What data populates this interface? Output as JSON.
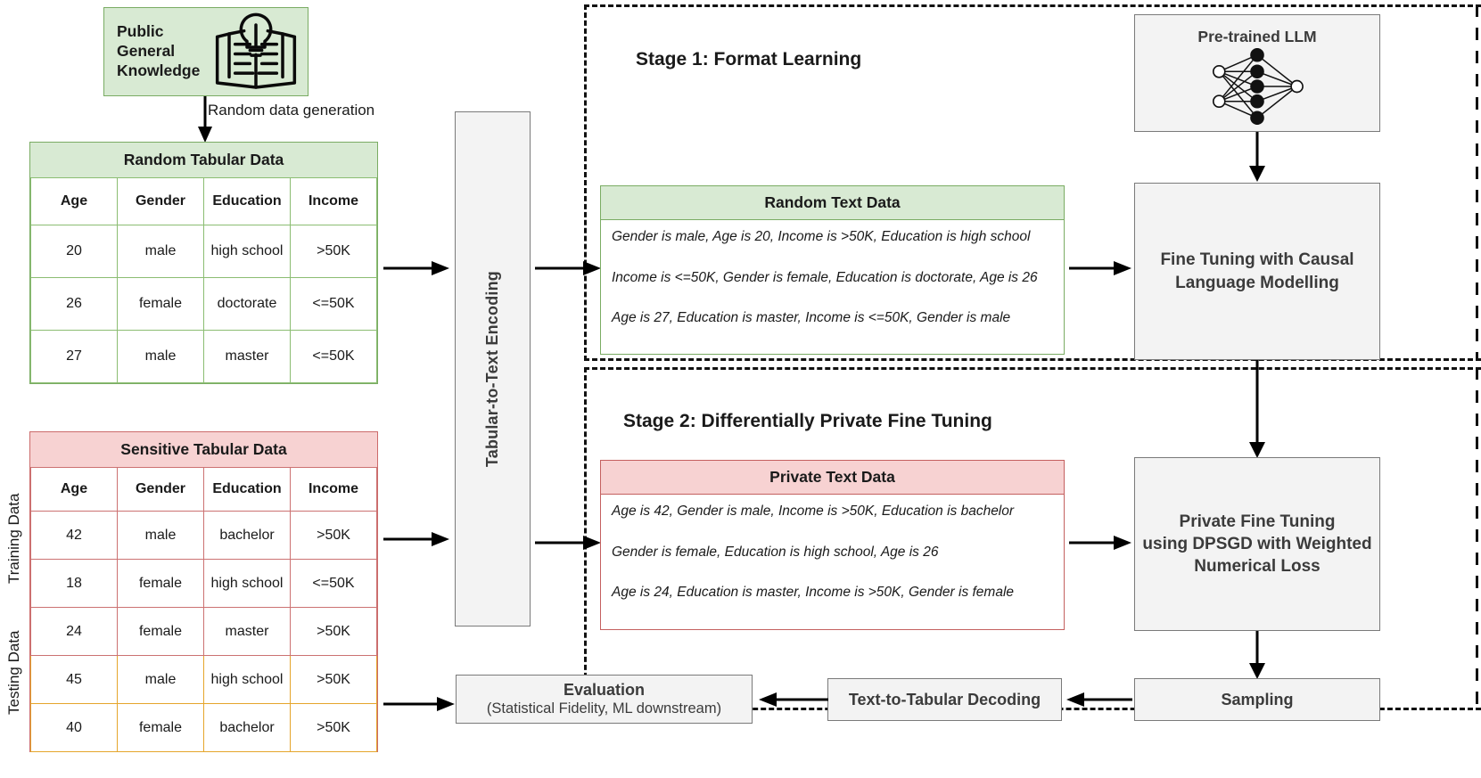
{
  "public_knowledge": {
    "label": "Public\nGeneral\nKnowledge",
    "line1": "Public",
    "line2": "General",
    "line3": "Knowledge",
    "icon": "open-book-lightbulb-icon",
    "fill": "#d8ead3",
    "stroke": "#7aac63"
  },
  "arrows": {
    "random_data_generation": "Random data generation"
  },
  "random_table": {
    "title": "Random Tabular Data",
    "fill": "#d8ead3",
    "stroke": "#7aac63",
    "columns": [
      "Age",
      "Gender",
      "Education",
      "Income"
    ],
    "rows": [
      [
        "20",
        "male",
        "high school",
        ">50K"
      ],
      [
        "26",
        "female",
        "doctorate",
        "<=50K"
      ],
      [
        "27",
        "male",
        "master",
        "<=50K"
      ]
    ]
  },
  "sensitive_table": {
    "title": "Sensitive Tabular Data",
    "fill": "#f7d2d2",
    "stroke": "#cc6b6b",
    "testing_stroke": "#e5a52b",
    "columns": [
      "Age",
      "Gender",
      "Education",
      "Income"
    ],
    "training_rows": [
      [
        "42",
        "male",
        "bachelor",
        ">50K"
      ],
      [
        "18",
        "female",
        "high school",
        "<=50K"
      ],
      [
        "24",
        "female",
        "master",
        ">50K"
      ]
    ],
    "testing_rows": [
      [
        "45",
        "male",
        "high school",
        ">50K"
      ],
      [
        "40",
        "female",
        "bachelor",
        ">50K"
      ]
    ],
    "side_labels": {
      "training": "Training Data",
      "testing": "Testing Data"
    }
  },
  "encoder": {
    "label": "Tabular-to-Text Encoding"
  },
  "stage1": {
    "title": "Stage 1: Format Learning",
    "text_card": {
      "title": "Random Text Data",
      "fill": "#d8ead3",
      "stroke": "#7aac63",
      "lines": [
        "Gender is male, Age is 20, Income is >50K, Education is high school",
        "Income is <=50K, Gender is female, Education is doctorate, Age is 26",
        "Age is 27, Education is master, Income is <=50K, Gender is male"
      ]
    }
  },
  "stage2": {
    "title": "Stage 2: Differentially Private Fine Tuning",
    "text_card": {
      "title": "Private Text Data",
      "fill": "#f7d2d2",
      "stroke": "#c4605f",
      "lines": [
        "Age is 42, Gender is male, Income is >50K, Education is bachelor",
        "Gender is female, Education is high school, Age is 26",
        "Age is 24, Education is master, Income is >50K, Gender is female"
      ]
    }
  },
  "pretrained_llm": {
    "label": "Pre-trained LLM",
    "icon": "neural-network-icon"
  },
  "fine_tuning": {
    "line1": "Fine Tuning with Causal",
    "line2": "Language Modelling"
  },
  "private_fine_tuning": {
    "line1": "Private Fine Tuning",
    "line2": "using DPSGD with Weighted",
    "line3": "Numerical Loss"
  },
  "sampling": {
    "label": "Sampling"
  },
  "decoding": {
    "label": "Text-to-Tabular Decoding"
  },
  "evaluation": {
    "title": "Evaluation",
    "subtitle": "(Statistical Fidelity, ML downstream)"
  }
}
